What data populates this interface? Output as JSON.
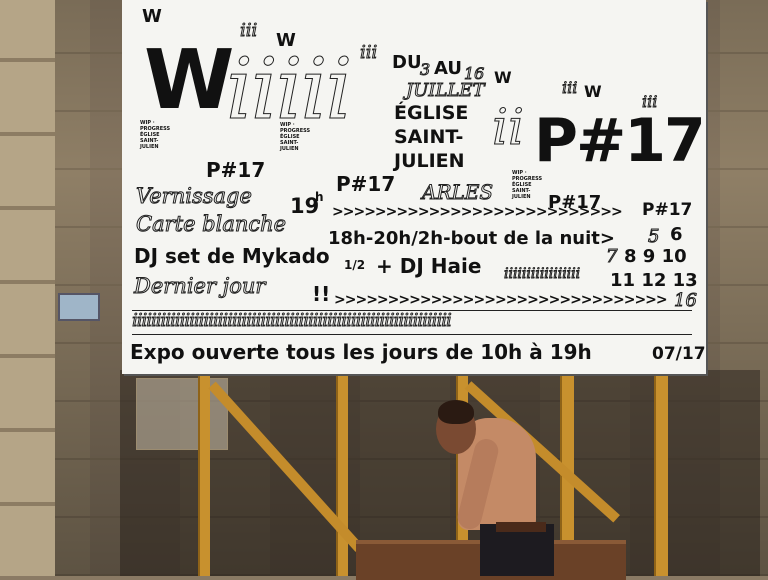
{
  "poster": {
    "big_w": "W",
    "outline_ii": "iiiii",
    "corner_w": "W",
    "small_iii": "iii",
    "du": "DU",
    "du_num": "3",
    "au": "AU",
    "au_num": "16",
    "month": "JUILLET",
    "church": [
      "ÉGLISE",
      "SAINT-",
      "JULIEN"
    ],
    "city": "ARLES",
    "mid_ii": "ii",
    "title": "P#17",
    "p17": "P#17",
    "line1_label": "Vernissage",
    "line1_time": "19",
    "line1_sup": "h",
    "line1_arrows": ">>>>>>>>>>>>>>>>>>>>>>>>>>>",
    "line1_day": "6",
    "line2_label": "Carte blanche",
    "line2_text": "18h-20h/2h-bout de la nuit>",
    "line2_day": "5",
    "line2_days2": "6",
    "line3_label": "DJ set de Mykado",
    "line3_half": "1/2",
    "line3_plus": "+ DJ Haie",
    "line3_days_outline": "7",
    "line3_days_a": "8  9  10",
    "line3_days_b": "11  12  13",
    "line3_iii": "iiiiiiiiiiiiiiiii",
    "line4_label": "Dernier jour",
    "line4_bang": "!!",
    "line4_arrows": ">>>>>>>>>>>>>>>>>>>>>>>>>>>>>>>",
    "line4_day": "16",
    "strip": "iiiiiiiiiiiiiiiiiiiiiiiiiiiiiiiiiiiiiiiiiiiiiiiiiiiiiiiiiiiiiiiiiii",
    "expo": "Expo ouverte tous les jours de 10h à 19h",
    "date": "07/17",
    "vert_text": "WIP · PROGRESS ÉGLISE SAINT-JULIEN"
  },
  "colors": {
    "wood": "#c8912e",
    "board": "#f5f5f2",
    "wall": "#8b7b63"
  },
  "icons": [
    "pictogram-sign-icon"
  ]
}
